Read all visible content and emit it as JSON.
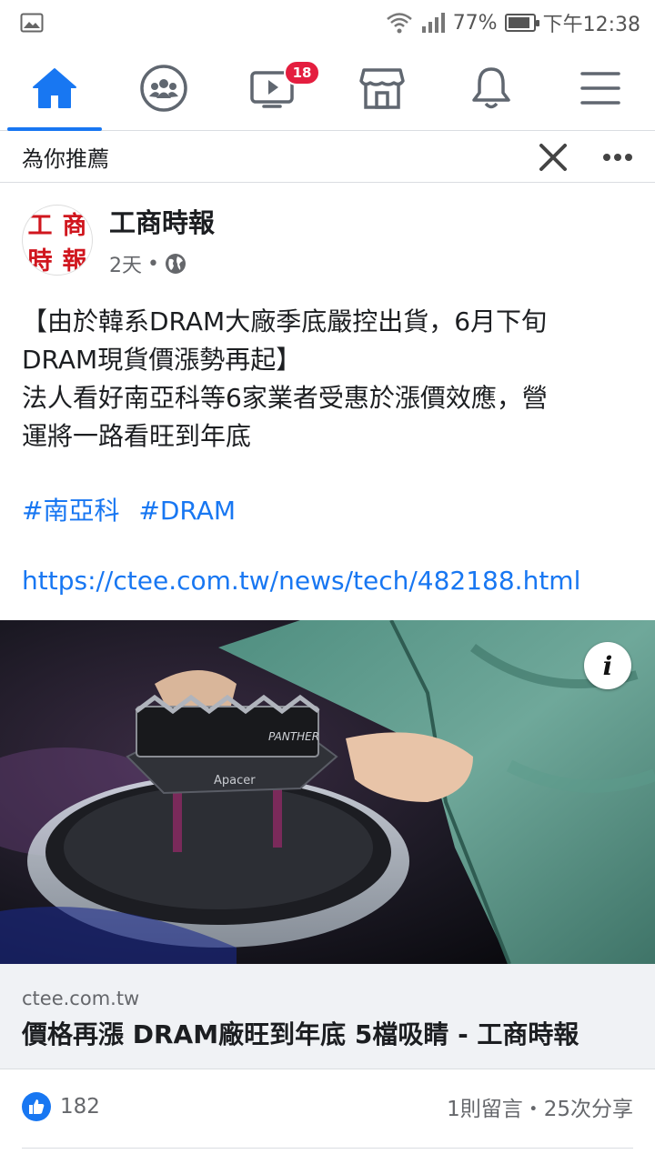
{
  "status_bar": {
    "battery": "77%",
    "battery_level": 0.77,
    "time": "下午12:38"
  },
  "nav": {
    "tabs": [
      {
        "name": "home",
        "icon": "home-icon",
        "active": true
      },
      {
        "name": "groups",
        "icon": "groups-icon",
        "active": false
      },
      {
        "name": "watch",
        "icon": "video-icon",
        "active": false,
        "badge": "18"
      },
      {
        "name": "marketplace",
        "icon": "store-icon",
        "active": false
      },
      {
        "name": "notifications",
        "icon": "bell-icon",
        "active": false
      },
      {
        "name": "menu",
        "icon": "hamburger-menu-icon",
        "active": false
      }
    ],
    "accent_color": "#1877f2"
  },
  "recommended": {
    "label": "為你推薦"
  },
  "post": {
    "page_name": "工商時報",
    "logo_chars": [
      "工",
      "商",
      "時",
      "報"
    ],
    "time": "2天",
    "text_lines": [
      "【由於韓系DRAM大廠季底嚴控出貨，6月下旬",
      "DRAM現貨價漲勢再起】",
      "法人看好南亞科等6家業者受惠於漲價效應，營",
      "運將一路看旺到年底"
    ],
    "hashtags": [
      "#南亞科",
      "#DRAM"
    ],
    "link": "https://ctee.com.tw/news/tech/482188.html",
    "photo_labels": {
      "product": "PANTHER",
      "brand": "Apacer"
    }
  },
  "link_preview": {
    "domain": "ctee.com.tw",
    "title": "價格再漲 DRAM廠旺到年底 5檔吸睛 - 工商時報"
  },
  "reactions": {
    "likes": "182",
    "counts": "1則留言・25次分享"
  }
}
